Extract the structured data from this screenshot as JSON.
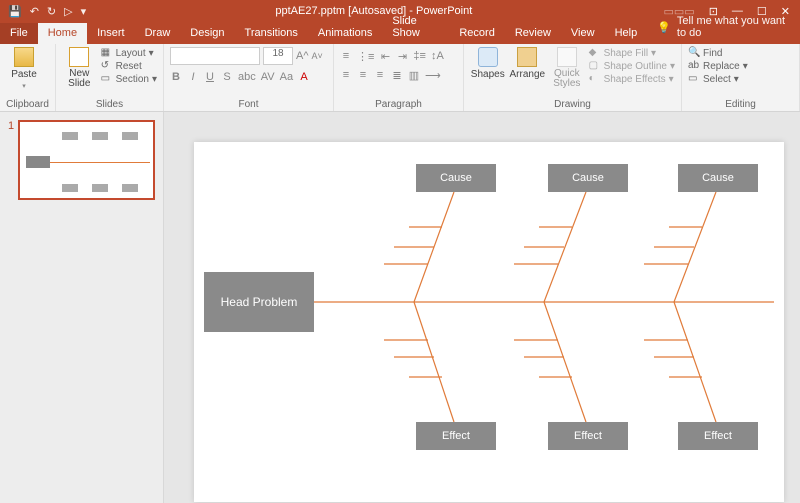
{
  "titlebar": {
    "title": "pptAE27.pptm [Autosaved] - PowerPoint"
  },
  "tabs": {
    "file": "File",
    "home": "Home",
    "insert": "Insert",
    "draw": "Draw",
    "design": "Design",
    "transitions": "Transitions",
    "animations": "Animations",
    "slideshow": "Slide Show",
    "record": "Record",
    "review": "Review",
    "view": "View",
    "help": "Help",
    "tellme": "Tell me what you want to do"
  },
  "ribbon": {
    "clipboard": {
      "label": "Clipboard",
      "paste": "Paste"
    },
    "slides": {
      "label": "Slides",
      "newslide": "New\nSlide",
      "layout": "Layout",
      "reset": "Reset",
      "section": "Section"
    },
    "font": {
      "label": "Font",
      "size": "18"
    },
    "paragraph": {
      "label": "Paragraph"
    },
    "drawing": {
      "label": "Drawing",
      "shapes": "Shapes",
      "arrange": "Arrange",
      "quick": "Quick\nStyles",
      "fill": "Shape Fill",
      "outline": "Shape Outline",
      "effects": "Shape Effects"
    },
    "editing": {
      "label": "Editing",
      "find": "Find",
      "replace": "Replace",
      "select": "Select"
    }
  },
  "thumbnail": {
    "num": "1"
  },
  "slide": {
    "head": "Head Problem",
    "cause": "Cause",
    "effect": "Effect"
  }
}
